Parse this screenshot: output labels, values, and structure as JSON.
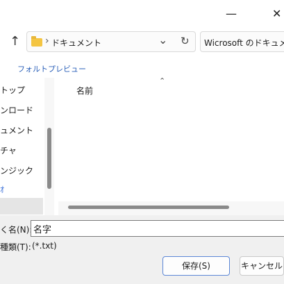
{
  "titlebar": {
    "minimize_glyph": "—",
    "close_glyph": "✕"
  },
  "address": {
    "up_glyph": "↑",
    "separator": "›",
    "path": "ドキュメント",
    "dropdown_glyph": "⌄",
    "refresh_glyph": "↻",
    "search_placeholder": "Wicrosoft のドキュメント"
  },
  "toolbar": {
    "font_preview_label": "フォルトプレビュー"
  },
  "nav": {
    "items": [
      "トップ",
      "ンロード",
      "ュメント",
      "チャ",
      "ンジック",
      "ｵ"
    ]
  },
  "filelist": {
    "sort_glyph": "⌃",
    "column_name": "名前"
  },
  "bottom": {
    "filename_label": "く名(N):",
    "filename_value": "名字",
    "filetype_label": "種類(T):",
    "filetype_value": "(*.txt)",
    "save_label": "保存(S)",
    "cancel_label": "キャンセル"
  },
  "colors": {
    "accent": "#3a6fd8",
    "nav_selected_bg": "#e5e5e5",
    "bottom_bg": "#f0f0f0"
  }
}
